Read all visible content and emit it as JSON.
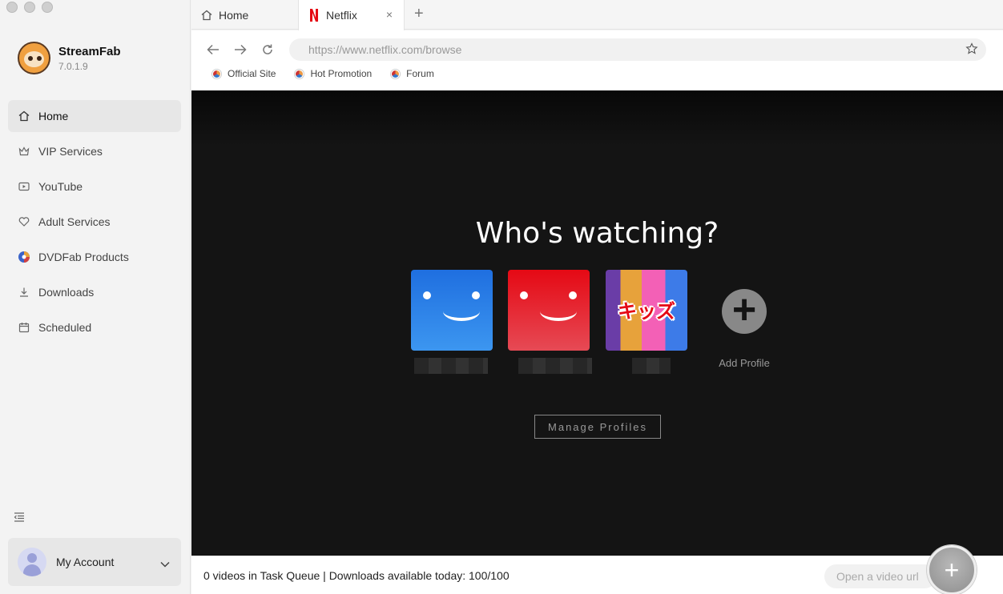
{
  "app": {
    "name": "StreamFab",
    "version": "7.0.1.9"
  },
  "sidebar": {
    "items": [
      {
        "label": "Home",
        "icon": "home-icon",
        "active": true
      },
      {
        "label": "VIP Services",
        "icon": "crown-icon"
      },
      {
        "label": "YouTube",
        "icon": "youtube-icon"
      },
      {
        "label": "Adult Services",
        "icon": "heart-icon"
      },
      {
        "label": "DVDFab Products",
        "icon": "dvdfab-icon"
      },
      {
        "label": "Downloads",
        "icon": "download-icon"
      },
      {
        "label": "Scheduled",
        "icon": "calendar-icon"
      }
    ],
    "account_label": "My Account"
  },
  "tabs": [
    {
      "label": "Home",
      "icon": "home-icon"
    },
    {
      "label": "Netflix",
      "icon": "netflix-icon",
      "active": true
    }
  ],
  "toolbar": {
    "url": "https://www.netflix.com/browse",
    "bookmarks": [
      "Official Site",
      "Hot Promotion",
      "Forum"
    ]
  },
  "netflix": {
    "heading": "Who's watching?",
    "kids_label": "キッズ",
    "add_profile_label": "Add Profile",
    "manage_label": "Manage Profiles"
  },
  "status": {
    "text": "0 videos in Task Queue | Downloads available today: 100/100",
    "open_url_placeholder": "Open a video url"
  },
  "colors": {
    "netflix_red": "#e50914",
    "netflix_bg": "#141414",
    "profile_blue": "#1f6fe0"
  }
}
